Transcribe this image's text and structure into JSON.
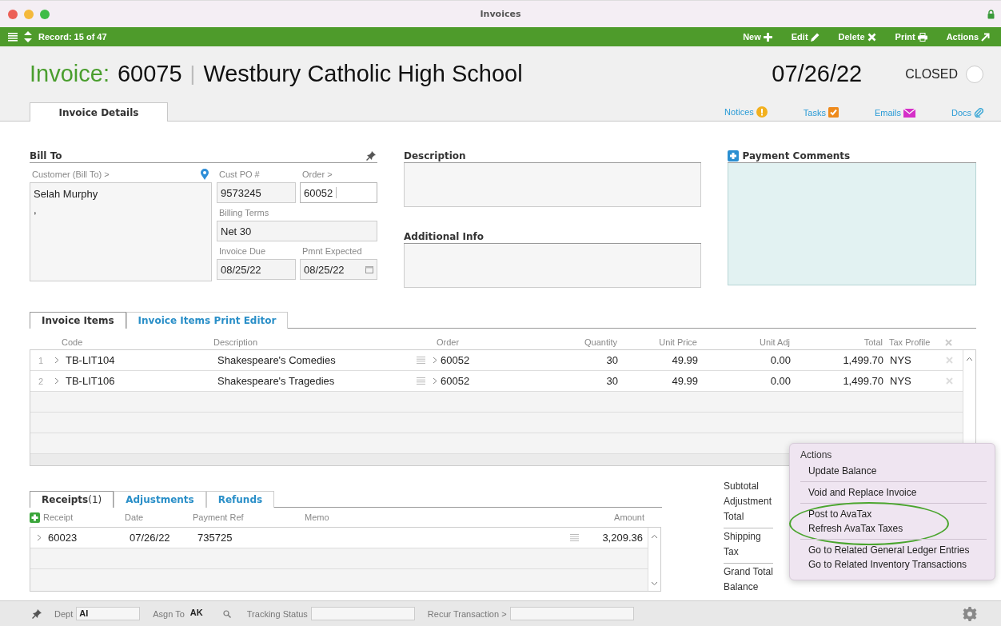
{
  "window": {
    "title": "Invoices"
  },
  "toolbar": {
    "record": "Record: 15 of 47",
    "buttons": [
      {
        "label": "New",
        "kind": "new"
      },
      {
        "label": "Edit",
        "kind": "edit"
      },
      {
        "label": "Delete",
        "kind": "delete"
      },
      {
        "label": "Print",
        "kind": "print"
      },
      {
        "label": "Actions",
        "kind": "actions"
      }
    ]
  },
  "header": {
    "label": "Invoice:",
    "number": "60075",
    "separator": "|",
    "customer": "Westbury Catholic High School",
    "date": "07/26/22",
    "status": "CLOSED",
    "checked": false
  },
  "tabs": [
    {
      "label": "Invoice Details",
      "selected": true
    }
  ],
  "links": [
    {
      "label": "Notices",
      "kind": "notices"
    },
    {
      "label": "Tasks",
      "kind": "tasks"
    },
    {
      "label": "Emails",
      "kind": "emails"
    },
    {
      "label": "Docs",
      "kind": "docs"
    }
  ],
  "bill_to": {
    "title": "Bill To",
    "customer_label": "Customer (Bill To) >",
    "customer_lines": [
      "Selah Murphy",
      ","
    ],
    "fields": [
      {
        "label": "Cust PO #",
        "value": "9573245",
        "kind": "text",
        "focused": false
      },
      {
        "label": "Order >",
        "value": "60052",
        "kind": "text",
        "focused": true
      },
      {
        "label": "Billing Terms",
        "value": "Net 30",
        "kind": "wide",
        "focused": false
      },
      {
        "label": "Invoice Due",
        "value": "08/25/22",
        "kind": "text",
        "focused": false
      },
      {
        "label": "Pmnt Expected",
        "value": "08/25/22",
        "kind": "date",
        "focused": false
      }
    ]
  },
  "description": {
    "title": "Description"
  },
  "additional_info": {
    "title": "Additional Info"
  },
  "payment_comments": {
    "title": "Payment Comments"
  },
  "item_tabs": [
    {
      "label": "Invoice Items",
      "selected": true
    },
    {
      "label": "Invoice Items Print Editor",
      "selected": false
    }
  ],
  "items": {
    "columns": [
      "Code",
      "Description",
      "Order",
      "Quantity",
      "Unit Price",
      "Unit Adj",
      "Total",
      "Tax Profile"
    ],
    "rows": [
      {
        "index": "1",
        "code": "TB-LIT104",
        "description": "Shakespeare's Comedies",
        "order": "60052",
        "quantity": "30",
        "unit_price": "49.99",
        "unit_adj": "0.00",
        "total": "1,499.70",
        "tax_profile": "NYS"
      },
      {
        "index": "2",
        "code": "TB-LIT106",
        "description": "Shakespeare's Tragedies",
        "order": "60052",
        "quantity": "30",
        "unit_price": "49.99",
        "unit_adj": "0.00",
        "total": "1,499.70",
        "tax_profile": "NYS"
      }
    ]
  },
  "receipt_tabs": [
    {
      "label": "Receipts",
      "count": "(1)",
      "selected": true
    },
    {
      "label": "Adjustments",
      "selected": false
    },
    {
      "label": "Refunds",
      "selected": false
    }
  ],
  "receipts": {
    "columns": [
      "Receipt",
      "Date",
      "Payment Ref",
      "Memo",
      "Amount"
    ],
    "rows": [
      {
        "receipt": "60023",
        "date": "07/26/22",
        "payment_ref": "735725",
        "amount": "3,209.36"
      }
    ]
  },
  "totals": [
    {
      "label": "Subtotal",
      "gap": false
    },
    {
      "label": "Adjustment",
      "gap": false
    },
    {
      "label": "Total",
      "gap": false
    },
    {
      "label": "Shipping",
      "gap": true
    },
    {
      "label": "Tax",
      "gap": false
    },
    {
      "label": "Grand Total",
      "gap": true
    },
    {
      "label": "Balance",
      "gap": false
    }
  ],
  "actions_menu": {
    "title": "Actions",
    "groups": [
      {
        "items": [
          "Update Balance"
        ],
        "circled": false
      },
      {
        "items": [
          "Void and Replace Invoice"
        ],
        "circled": false
      },
      {
        "items": [
          "Post to AvaTax",
          "Refresh AvaTax Taxes"
        ],
        "circled": true
      },
      {
        "items": [
          "Go to Related General Ledger Entries",
          "Go to Related Inventory Transactions"
        ],
        "circled": false
      }
    ]
  },
  "footer": {
    "fields": [
      {
        "label": "Dept",
        "value": "AI",
        "kind": "short"
      },
      {
        "label": "Asgn To",
        "value": "AK",
        "kind": "search"
      },
      {
        "label": "Tracking Status",
        "kind": "medium"
      },
      {
        "label": "Recur Transaction >",
        "kind": "long"
      }
    ]
  }
}
